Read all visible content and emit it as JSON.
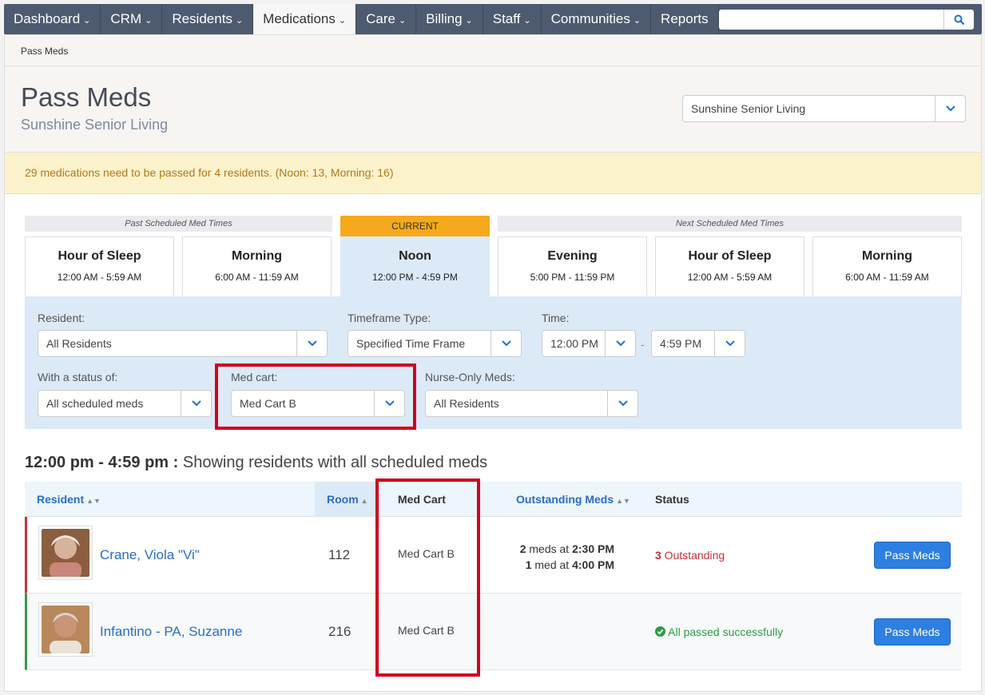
{
  "nav": {
    "items": [
      {
        "label": "Dashboard",
        "dropdown": true
      },
      {
        "label": "CRM",
        "dropdown": true
      },
      {
        "label": "Residents",
        "dropdown": true
      },
      {
        "label": "Medications",
        "dropdown": true,
        "active": true
      },
      {
        "label": "Care",
        "dropdown": true
      },
      {
        "label": "Billing",
        "dropdown": true
      },
      {
        "label": "Staff",
        "dropdown": true
      },
      {
        "label": "Communities",
        "dropdown": true
      },
      {
        "label": "Reports",
        "dropdown": false
      }
    ],
    "search_placeholder": ""
  },
  "breadcrumb": "Pass Meds",
  "header": {
    "title": "Pass Meds",
    "subtitle": "Sunshine Senior Living",
    "community_select": "Sunshine Senior Living"
  },
  "alert": "29 medications need to be passed for 4 residents. (Noon: 13, Morning: 16)",
  "timeframes": {
    "past_label": "Past Scheduled Med Times",
    "current_label": "CURRENT",
    "next_label": "Next Scheduled Med Times",
    "cards": [
      {
        "name": "Hour of Sleep",
        "range": "12:00 AM - 5:59 AM"
      },
      {
        "name": "Morning",
        "range": "6:00 AM - 11:59 AM"
      },
      {
        "name": "Noon",
        "range": "12:00 PM - 4:59 PM"
      },
      {
        "name": "Evening",
        "range": "5:00 PM - 11:59 PM"
      },
      {
        "name": "Hour of Sleep",
        "range": "12:00 AM - 5:59 AM"
      },
      {
        "name": "Morning",
        "range": "6:00 AM - 11:59 AM"
      }
    ]
  },
  "filters": {
    "resident_label": "Resident:",
    "resident_value": "All Residents",
    "timeframe_label": "Timeframe Type:",
    "timeframe_value": "Specified Time Frame",
    "time_label": "Time:",
    "time_start": "12:00 PM",
    "time_sep": "-",
    "time_end": "4:59 PM",
    "status_label": "With a status of:",
    "status_value": "All scheduled meds",
    "medcart_label": "Med cart:",
    "medcart_value": "Med Cart B",
    "nurse_label": "Nurse-Only Meds:",
    "nurse_value": "All Residents"
  },
  "section": {
    "time_range": "12:00 pm - 4:59 pm :",
    "description": "Showing residents with all scheduled meds"
  },
  "table": {
    "columns": [
      "Resident",
      "Room",
      "Med Cart",
      "Outstanding Meds",
      "Status"
    ],
    "rows": [
      {
        "name": "Crane, Viola \"Vi\"",
        "room": "112",
        "med_cart": "Med Cart B",
        "meds_line1_count": "2",
        "meds_line1_text": " meds at ",
        "meds_line1_time": "2:30 PM",
        "meds_line2_count": "1",
        "meds_line2_text": " med at ",
        "meds_line2_time": "4:00 PM",
        "status_count": "3",
        "status_text": " Outstanding",
        "button": "Pass Meds"
      },
      {
        "name": "Infantino - PA, Suzanne",
        "room": "216",
        "med_cart": "Med Cart B",
        "status_text": "All passed successfully",
        "button": "Pass Meds"
      }
    ]
  },
  "colors": {
    "nav_bg": "#4d5a70",
    "accent": "#2d7fe1",
    "current_tag": "#f5a91c",
    "highlight": "#d0021b",
    "outstanding": "#c7313a",
    "success": "#2f9a46"
  }
}
